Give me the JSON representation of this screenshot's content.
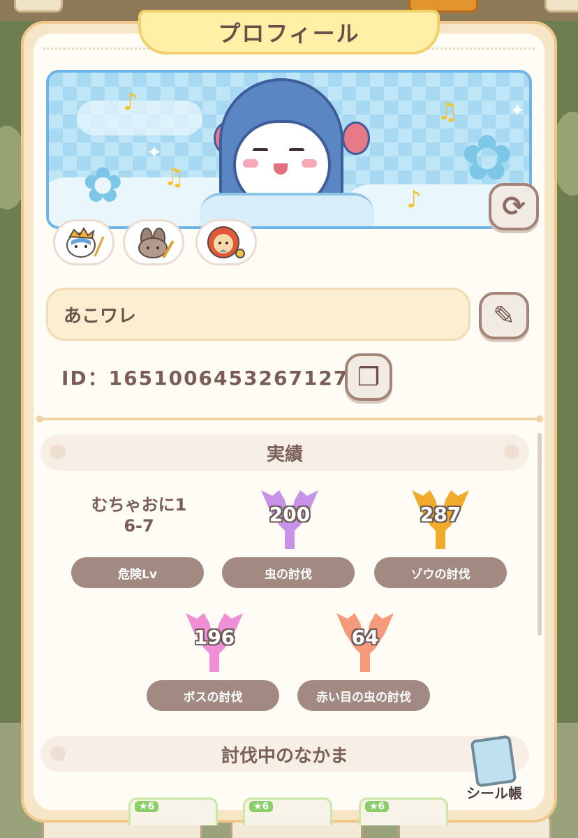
{
  "modal": {
    "title": "プロフィール",
    "player_name": "あこワレ",
    "player_id": "ID：1651006453267127"
  },
  "icons": {
    "refresh": "refresh-icon",
    "edit": "pencil-icon",
    "copy": "copy-icon",
    "sticker_book": "sticker-book-icon"
  },
  "badges": [
    "hachiware-badge",
    "usagi-badge",
    "shisa-badge"
  ],
  "achievements": {
    "header": "実績",
    "items": [
      {
        "value": "むちゃおに1\n6-7",
        "label": "危険Lv",
        "color": null
      },
      {
        "value": "200",
        "label": "虫の討伐",
        "color": "#c792e8"
      },
      {
        "value": "287",
        "label": "ゾウの討伐",
        "color": "#f0aa2c"
      },
      {
        "value": "196",
        "label": "ボスの討伐",
        "color": "#f08ed6"
      },
      {
        "value": "64",
        "label": "赤い目の虫の討伐",
        "color": "#f59a7a"
      }
    ]
  },
  "companions": {
    "header": "討伐中のなかま",
    "cards": [
      {
        "lv": "★6"
      },
      {
        "lv": "★6"
      },
      {
        "lv": "★6"
      }
    ]
  },
  "sticker_book_label": "シール帳",
  "colors": {
    "accent_border": "#f0c78a",
    "button_border": "#a48479",
    "label_fill": "#a28a82"
  }
}
